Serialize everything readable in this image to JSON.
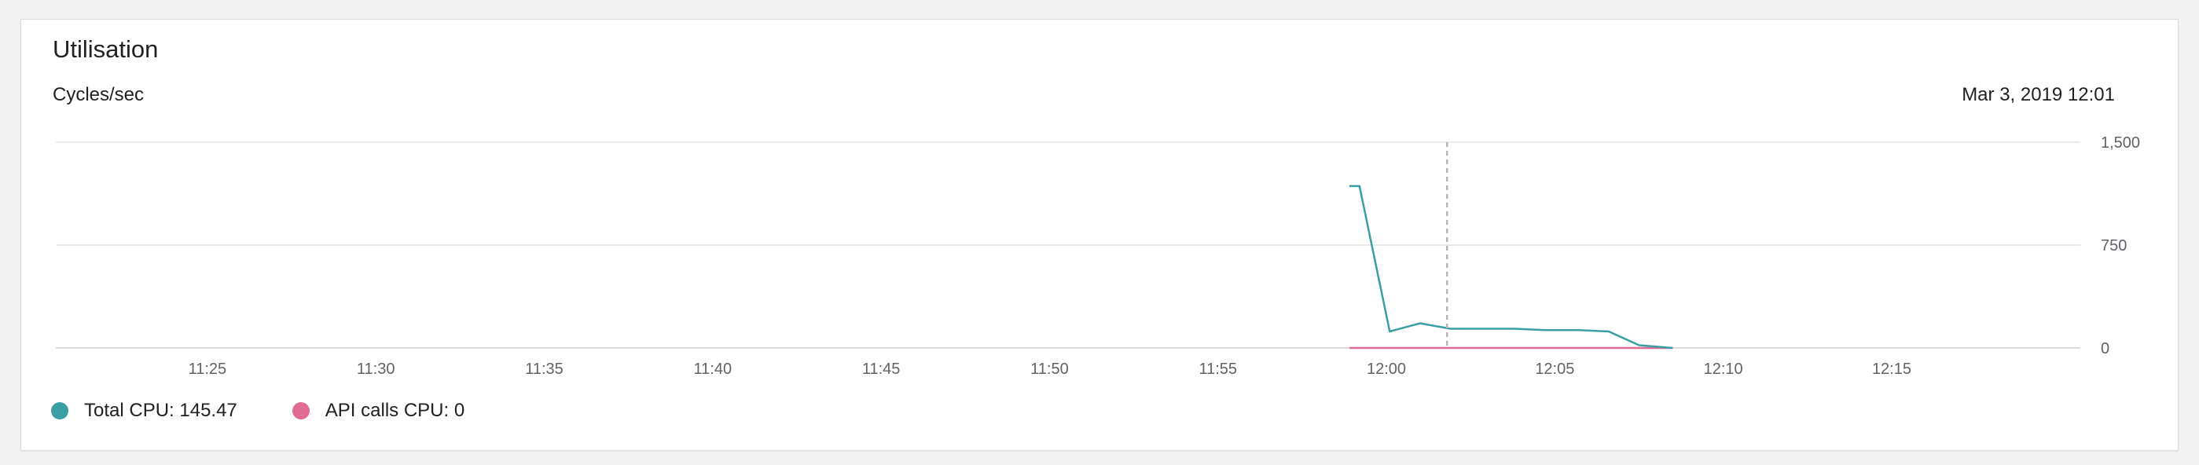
{
  "card": {
    "title": "Utilisation",
    "subtitle": "Cycles/sec",
    "timestamp": "Mar 3, 2019 12:01"
  },
  "legend": {
    "total_label": "Total CPU: 145.47",
    "api_label": "API calls CPU: 0"
  },
  "colors": {
    "total_cpu": "#3a9ea5",
    "api_cpu": "#e06b93",
    "grid": "#e3e3e3",
    "cursor": "#b5b5b5"
  },
  "chart_data": {
    "type": "line",
    "xlabel": "",
    "ylabel": "Cycles/sec",
    "xlim": [
      1280,
      2520
    ],
    "ylim": [
      0,
      1500
    ],
    "y_ticks": [
      0,
      750,
      1500
    ],
    "y_tick_labels": [
      "0",
      "750",
      "1,500"
    ],
    "x_ticks": [
      1285,
      1290,
      1295,
      1300,
      1305,
      1310,
      1315,
      1320,
      1325,
      1330,
      1335
    ],
    "x_tick_labels": [
      "11:25",
      "11:30",
      "11:35",
      "11:40",
      "11:45",
      "11:50",
      "11:55",
      "12:00",
      "12:05",
      "12:10",
      "12:15"
    ],
    "cursor_x": 1321.8,
    "grid": true,
    "legend_position": "bottom-left",
    "series": [
      {
        "name": "Total CPU",
        "x": [
          1318.9,
          1319.2,
          1320.1,
          1321.0,
          1321.9,
          1322.9,
          1323.8,
          1324.7,
          1325.7,
          1326.6,
          1327.5,
          1328.5
        ],
        "y": [
          1180,
          1180,
          120,
          180,
          140,
          140,
          140,
          130,
          130,
          120,
          20,
          0
        ]
      },
      {
        "name": "API calls CPU",
        "x": [
          1318.9,
          1328.5
        ],
        "y": [
          0,
          0
        ]
      }
    ]
  }
}
